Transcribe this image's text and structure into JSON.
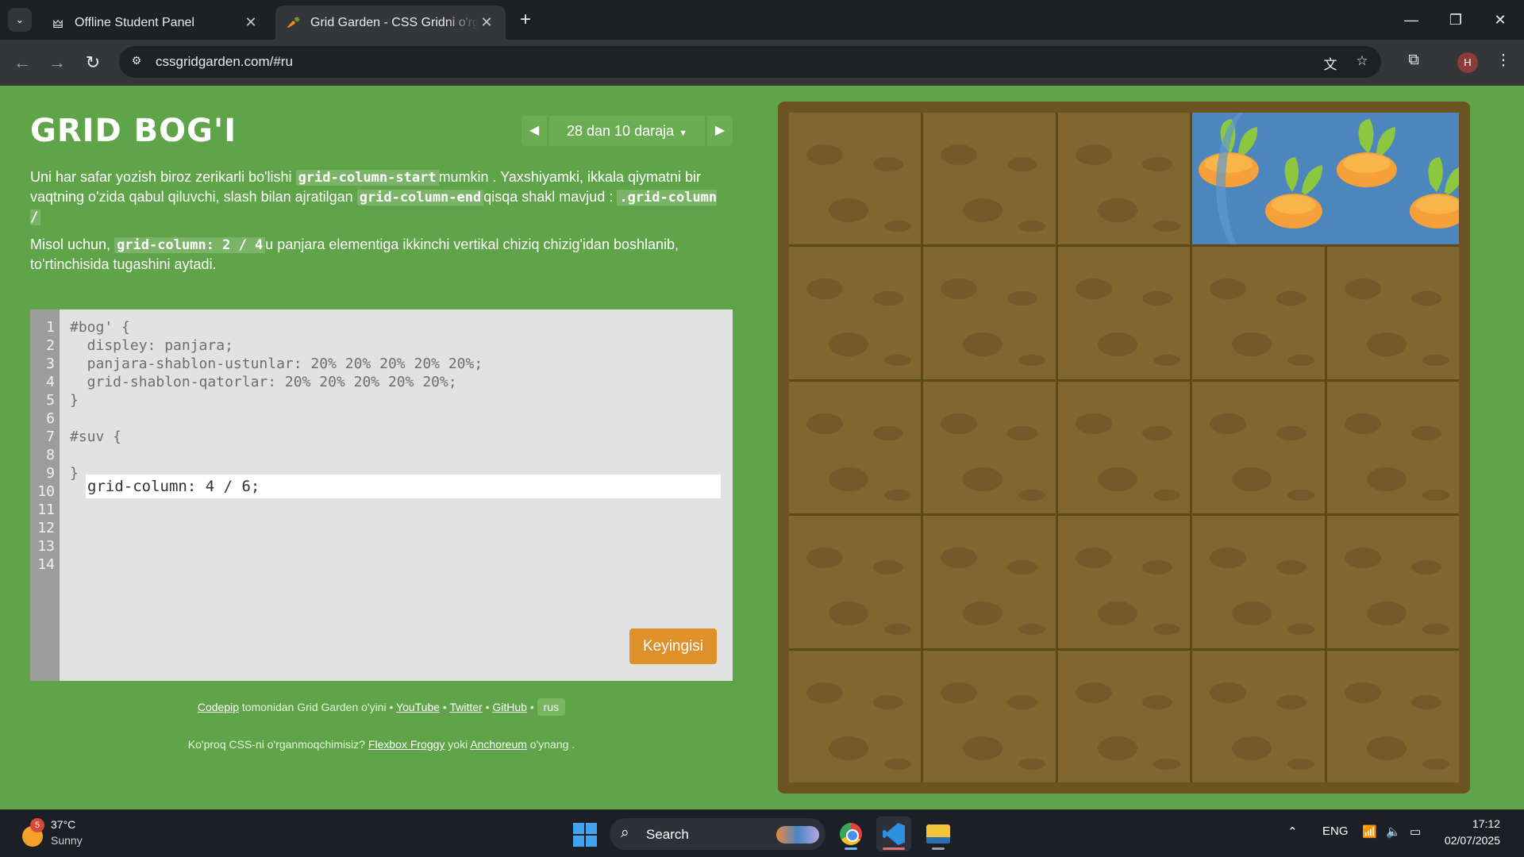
{
  "browser": {
    "tabs": [
      {
        "title": "Offline Student Panel",
        "active": false,
        "icon": "student-panel-favicon"
      },
      {
        "title": "Grid Garden - CSS Gridni o'rganish",
        "active": true,
        "icon": "carrot-favicon"
      }
    ],
    "url": "cssgridgarden.com/#ru",
    "profile_initial": "H"
  },
  "game": {
    "title": "GRID BOG'I",
    "level_label": "28 dan 10  daraja",
    "instructions": {
      "p1_a": "Uni har safar yozish biroz zerikarli bo'lishi ",
      "p1_code1": "grid-column-start",
      "p1_b": "mumkin . Yaxshiyamki, ikkala qiymatni bir vaqtning o'zida qabul qiluvchi, slash bilan ajratilgan ",
      "p1_code2": "grid-column-end",
      "p1_c": "qisqa shakl mavjud : ",
      "p1_code3": ".grid-column /",
      "p2_a": "Misol uchun, ",
      "p2_code": "grid-column: 2 / 4",
      "p2_b": "u panjara elementiga ikkinchi vertikal chiziq chizig'idan boshlanib, to'rtinchisida tugashini aytadi."
    },
    "editor": {
      "line_numbers": [
        "1",
        "2",
        "3",
        "4",
        "5",
        "6",
        "7",
        "8",
        "9",
        "10",
        "11",
        "12",
        "13",
        "14"
      ],
      "lines": [
        "#bog' {",
        "  displey: panjara;",
        "  panjara-shablon-ustunlar: 20% 20% 20% 20% 20%;",
        "  grid-shablon-qatorlar: 20% 20% 20% 20% 20%;",
        "}",
        "",
        "#suv {",
        "",
        "}"
      ],
      "input_value": "grid-column: 4 / 6;",
      "next_button": "Keyingisi"
    },
    "credits": {
      "codepip": "Codepip",
      "by_text": " tomonidan Grid Garden o'yini • ",
      "youtube": "YouTube",
      "sep": " • ",
      "twitter": "Twitter",
      "github": "GitHub",
      "lang": "rus"
    },
    "promo": {
      "a": "Ko'proq CSS-ni o'rganmoqchimisiz? ",
      "flexbox": "Flexbox Froggy",
      "b": " yoki ",
      "anchoreum": "Anchoreum",
      "c": " o'ynang ."
    },
    "garden": {
      "columns": 5,
      "rows": 5,
      "water_grid_column": "4 / 6",
      "water_row": 1
    }
  },
  "taskbar": {
    "weather_temp": "37°C",
    "weather_condition": "Sunny",
    "weather_badge": "5",
    "search_label": "Search",
    "language": "ENG",
    "time": "17:12",
    "date": "02/07/2025"
  },
  "colors": {
    "page_bg": "#5fa448",
    "soil": "#826630",
    "water": "#4d86bd",
    "next_button": "#e0902a"
  }
}
